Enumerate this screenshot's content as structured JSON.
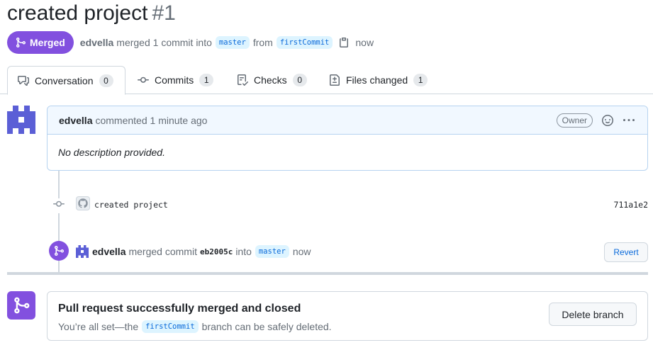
{
  "pr": {
    "title": "created project",
    "number": "#1",
    "state_label": "Merged",
    "author": "edvella",
    "merged_text": "merged 1 commit into",
    "base_branch": "master",
    "from_text": "from",
    "head_branch": "firstCommit",
    "time": "now"
  },
  "tabs": [
    {
      "label": "Conversation",
      "count": "0",
      "icon": "comment-discussion-icon"
    },
    {
      "label": "Commits",
      "count": "1",
      "icon": "git-commit-icon"
    },
    {
      "label": "Checks",
      "count": "0",
      "icon": "checklist-icon"
    },
    {
      "label": "Files changed",
      "count": "1",
      "icon": "file-diff-icon"
    }
  ],
  "comment": {
    "author": "edvella",
    "action": "commented 1 minute ago",
    "role": "Owner",
    "body": "No description provided."
  },
  "commit": {
    "message": "created project",
    "sha": "711a1e2"
  },
  "merge_event": {
    "author": "edvella",
    "text1": "merged commit",
    "sha": "eb2005c",
    "text2": "into",
    "branch": "master",
    "time": "now",
    "revert_label": "Revert"
  },
  "merged_box": {
    "title": "Pull request successfully merged and closed",
    "sub_prefix": "You’re all set—the",
    "branch": "firstCommit",
    "sub_suffix": "branch can be safely deleted.",
    "delete_label": "Delete branch"
  },
  "colors": {
    "merged_purple": "#8250df",
    "link_blue": "#0969da",
    "comment_header_bg": "#f1f8ff"
  }
}
